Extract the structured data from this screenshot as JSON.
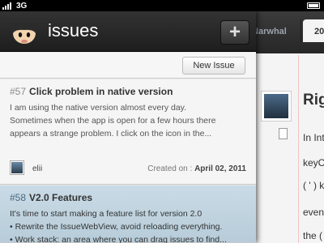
{
  "status_bar": {
    "network": "3G"
  },
  "app": {
    "title": "issues",
    "add_symbol": "+",
    "new_issue_label": "New Issue"
  },
  "issues": [
    {
      "number": "#57",
      "title": "Click problem in native version",
      "body": [
        "I am using the native version almost every day.",
        "Sometimes when the app is open for a few hours there",
        "appears a strange problem. I click on the icon in the..."
      ],
      "author": "elii",
      "created_label": "Created on :",
      "created_date": "April 02, 2011"
    },
    {
      "number": "#58",
      "title": "V2.0 Features",
      "body": [
        "It's time to start making a feature list for version 2.0",
        "• Rewrite the IssueWebView, avoid reloading everything.",
        "• Work stack: an area where you can drag issues to find..."
      ]
    }
  ],
  "background": {
    "tab1": "/Narwhal",
    "tab2": "20",
    "title": "Rig",
    "lines": [
      "In Int",
      "keyC",
      "( ' ) k",
      "even",
      "the ("
    ]
  }
}
